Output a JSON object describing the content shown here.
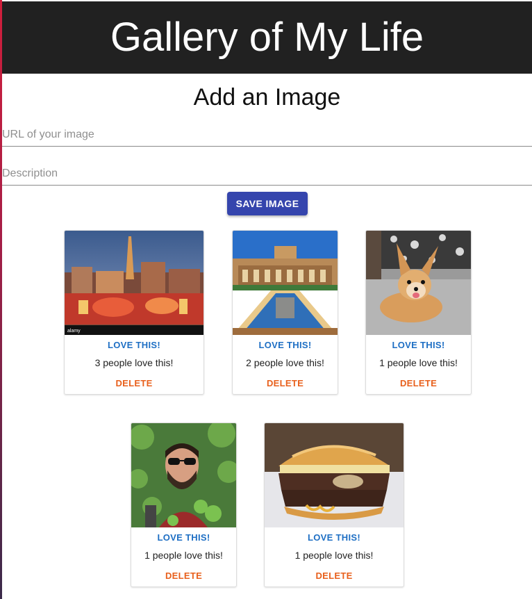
{
  "header": {
    "title": "Gallery of My Life"
  },
  "form": {
    "title": "Add an Image",
    "url_placeholder": "URL of your image",
    "description_placeholder": "Description",
    "save_label": "SAVE IMAGE"
  },
  "cards": [
    {
      "love_label": "LOVE THIS!",
      "count_text": "3 people love this!",
      "delete_label": "DELETE",
      "image": "city-skyline-night-image"
    },
    {
      "love_label": "LOVE THIS!",
      "count_text": "2 people love this!",
      "delete_label": "DELETE",
      "image": "palace-reflecting-pool-image"
    },
    {
      "love_label": "LOVE THIS!",
      "count_text": "1 people love this!",
      "delete_label": "DELETE",
      "image": "small-dog-image"
    },
    {
      "love_label": "LOVE THIS!",
      "count_text": "1 people love this!",
      "delete_label": "DELETE",
      "image": "man-sunglasses-portrait-image"
    },
    {
      "love_label": "LOVE THIS!",
      "count_text": "1 people love this!",
      "delete_label": "DELETE",
      "image": "burger-image"
    }
  ],
  "colors": {
    "header_bg": "#212121",
    "button": "#3545ad",
    "love": "#1e6fc4",
    "delete": "#e8601c"
  }
}
